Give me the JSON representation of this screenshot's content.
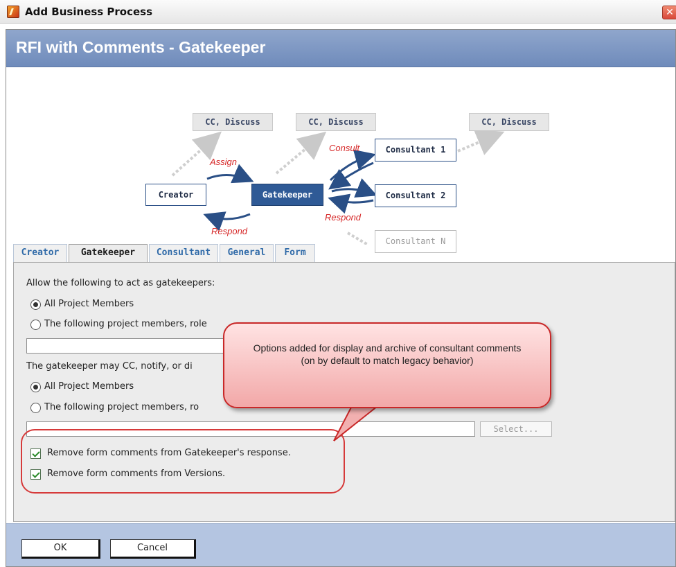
{
  "window": {
    "title": "Add Business Process",
    "close_glyph": "✕",
    "icon": "app-icon"
  },
  "header": {
    "process_title": "RFI with Comments - Gatekeeper"
  },
  "diagram": {
    "nodes": {
      "cc1": "CC, Discuss",
      "cc2": "CC, Discuss",
      "cc3": "CC, Discuss",
      "creator": "Creator",
      "gatekeeper": "Gatekeeper",
      "consultant1": "Consultant 1",
      "consultant2": "Consultant 2",
      "consultantN": "Consultant N"
    },
    "edge_labels": {
      "assign": "Assign",
      "respond_left": "Respond",
      "consult": "Consult",
      "respond_right": "Respond"
    }
  },
  "tabs": [
    {
      "label": "Creator",
      "active": false
    },
    {
      "label": "Gatekeeper",
      "active": true
    },
    {
      "label": "Consultant",
      "active": false
    },
    {
      "label": "General",
      "active": false
    },
    {
      "label": "Form",
      "active": false
    }
  ],
  "panel": {
    "section1_label": "Allow the following to act as gatekeepers:",
    "radio1_all": "All Project Members",
    "radio1_following": "The following project members, role",
    "section2_label": "The gatekeeper may CC, notify, or di",
    "radio2_all": "All Project Members",
    "radio2_following": "The following project members, ro",
    "select_label": "Select...",
    "checkbox1": "Remove form comments from Gatekeeper's response.",
    "checkbox2": "Remove form comments from Versions.",
    "radio1_selected": "all",
    "radio2_selected": "all",
    "checkbox1_checked": true,
    "checkbox2_checked": true
  },
  "callout": {
    "text": "Options added for display and archive of consultant comments (on by default to match legacy behavior)"
  },
  "footer": {
    "ok_label": "OK",
    "cancel_label": "Cancel"
  },
  "colors": {
    "header_band": "#7a93c2",
    "gatekeeper_node": "#2f5a96",
    "edge_label": "#d62828",
    "callout_border": "#c82828"
  }
}
